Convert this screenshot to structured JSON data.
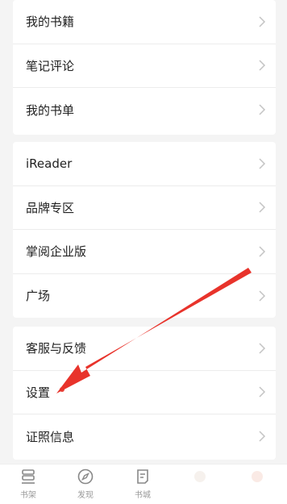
{
  "groups": {
    "group1": [
      {
        "label": "我的书籍"
      },
      {
        "label": "笔记评论"
      },
      {
        "label": "我的书单"
      }
    ],
    "group2": [
      {
        "label": "iReader"
      },
      {
        "label": "品牌专区"
      },
      {
        "label": "掌阅企业版"
      },
      {
        "label": "广场"
      }
    ],
    "group3": [
      {
        "label": "客服与反馈"
      },
      {
        "label": "设置"
      },
      {
        "label": "证照信息"
      }
    ]
  },
  "tabbar": {
    "tabs": [
      {
        "label": "书架",
        "icon": "bookshelf-icon"
      },
      {
        "label": "发现",
        "icon": "compass-icon"
      },
      {
        "label": "书城",
        "icon": "bookstore-icon"
      },
      {
        "label": "",
        "icon": "faded-icon"
      },
      {
        "label": "",
        "icon": "faded-icon"
      }
    ]
  },
  "annotation": {
    "arrow_color": "#e8332b",
    "target": "设置"
  },
  "colors": {
    "background": "#f4f4f4",
    "card": "#ffffff",
    "notification_dot": "#e8453c"
  }
}
